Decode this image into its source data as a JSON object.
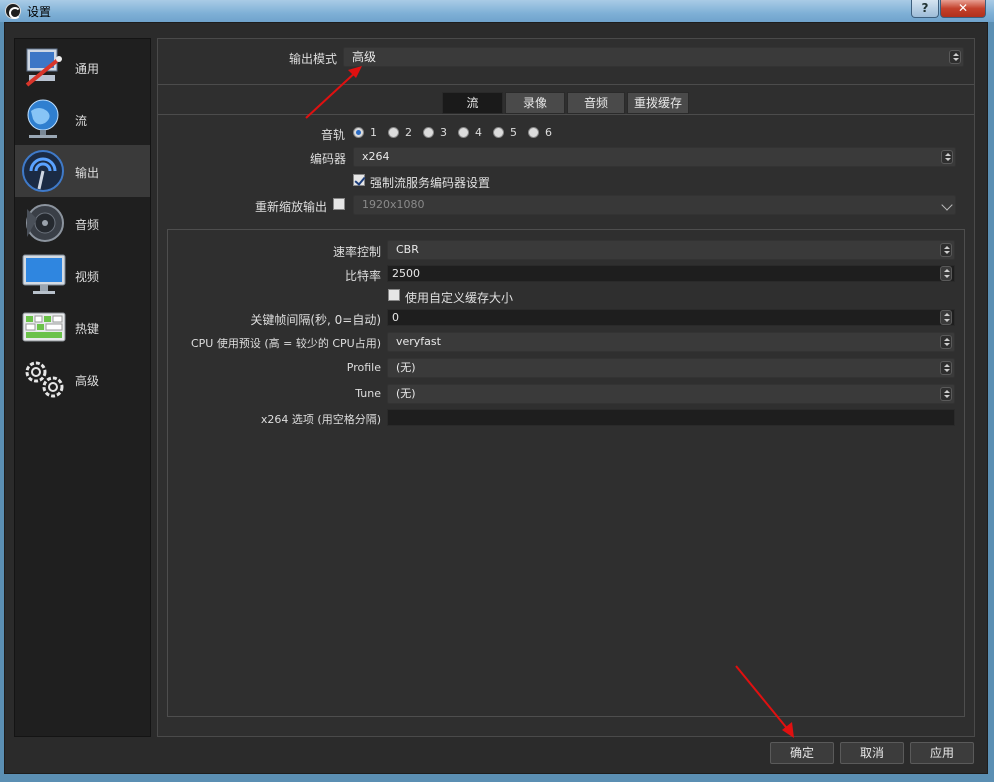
{
  "window": {
    "title": "设置",
    "help": "?",
    "close": "✕"
  },
  "sidebar": {
    "items": [
      {
        "label": "通用",
        "icon": "general-icon"
      },
      {
        "label": "流",
        "icon": "stream-globe-icon"
      },
      {
        "label": "输出",
        "icon": "output-icon",
        "active": true
      },
      {
        "label": "音频",
        "icon": "audio-speaker-icon"
      },
      {
        "label": "视频",
        "icon": "video-monitor-icon"
      },
      {
        "label": "热键",
        "icon": "hotkeys-keyboard-icon"
      },
      {
        "label": "高级",
        "icon": "advanced-gears-icon"
      }
    ]
  },
  "output": {
    "mode_label": "输出模式",
    "mode_value": "高级",
    "tabs": [
      {
        "label": "流",
        "active": true
      },
      {
        "label": "录像"
      },
      {
        "label": "音频"
      },
      {
        "label": "重拨缓存"
      }
    ],
    "audio_track_label": "音轨",
    "audio_tracks": [
      "1",
      "2",
      "3",
      "4",
      "5",
      "6"
    ],
    "audio_track_selected": "1",
    "encoder_label": "编码器",
    "encoder_value": "x264",
    "enforce_label": "强制流服务编码器设置",
    "enforce_checked": true,
    "rescale_label": "重新缩放输出",
    "rescale_checked": false,
    "rescale_value": "1920x1080"
  },
  "encoder_settings": {
    "rate_control_label": "速率控制",
    "rate_control_value": "CBR",
    "bitrate_label": "比特率",
    "bitrate_value": "2500",
    "custom_buffer_label": "使用自定义缓存大小",
    "custom_buffer_checked": false,
    "keyframe_label": "关键帧间隔(秒, 0=自动)",
    "keyframe_value": "0",
    "cpu_preset_label": "CPU 使用预设 (高 = 较少的 CPU占用)",
    "cpu_preset_value": "veryfast",
    "profile_label": "Profile",
    "profile_value": "(无)",
    "tune_label": "Tune",
    "tune_value": "(无)",
    "x264_opts_label": "x264 选项 (用空格分隔)",
    "x264_opts_value": ""
  },
  "buttons": {
    "ok": "确定",
    "cancel": "取消",
    "apply": "应用"
  },
  "colors": {
    "annotation_arrow": "#e01010",
    "accent": "#2b6cc4"
  }
}
